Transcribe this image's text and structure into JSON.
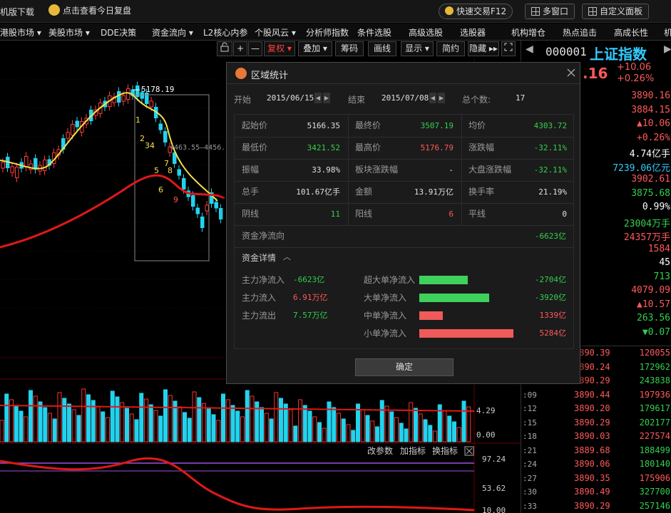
{
  "topbar": {
    "download": "机版下载",
    "review": "点击查看今日复盘",
    "quick_trade": "快速交易F12",
    "multi_window": "多窗口",
    "custom_panel": "自定义面板"
  },
  "nav": [
    "港股市场 ▾",
    "美股市场 ▾",
    "DDE决策",
    "资金流向 ▾",
    "L2核心内参",
    "个股风云 ▾",
    "分析师指数",
    "条件选股",
    "高级选股",
    "选股器",
    "机构增仓",
    "热点追击",
    "高成长性",
    "机"
  ],
  "toolbar": {
    "buttons": [
      "+",
      "—",
      "复权 ▾",
      "叠加 ▾",
      "筹码",
      "画线",
      "显示 ▾",
      "简约",
      "隐藏 ▸▸"
    ]
  },
  "chart": {
    "high_label": "5178.19",
    "range_label": "4463.55—4456.",
    "wave_labels": [
      "1",
      "2",
      "3",
      "4",
      "5",
      "6",
      "7",
      "8",
      "9"
    ],
    "volume_ticks": [
      "4.29",
      "0.00"
    ],
    "indicator_menu": [
      "改参数",
      "加指标",
      "换指标"
    ],
    "indicator_ticks": [
      "97.24",
      "53.62",
      "10.00"
    ]
  },
  "right_panel": {
    "code": "000001",
    "name": "上证指数",
    "price_tail": ".16",
    "change": "+10.06",
    "change_pct": "+0.26%",
    "values": [
      {
        "v": "3890.16",
        "c": "#ff5a5a"
      },
      {
        "v": "3884.15",
        "c": "#ff5a5a"
      },
      {
        "v": "▲10.06",
        "c": "#ff5a5a"
      },
      {
        "v": "+0.26%",
        "c": "#ff5a5a"
      },
      {
        "v": "4.74亿手",
        "c": "#ffffff"
      },
      {
        "v": "7239.06亿元",
        "c": "#33ccff"
      },
      {
        "v": "3902.61",
        "c": "#ff5a5a"
      },
      {
        "v": "3875.68",
        "c": "#33d04e"
      },
      {
        "v": "0.99%",
        "c": "#ffffff"
      },
      {
        "v": "23004万手",
        "c": "#33d04e"
      },
      {
        "v": "24357万手",
        "c": "#ff5a5a"
      },
      {
        "v": "1584",
        "c": "#ff5a5a"
      },
      {
        "v": "45",
        "c": "#ffffff"
      },
      {
        "v": "713",
        "c": "#33d04e"
      },
      {
        "v": "4079.09",
        "c": "#ff5a5a"
      },
      {
        "v": "▲10.57",
        "c": "#ff5a5a"
      },
      {
        "v": "263.56",
        "c": "#33d04e"
      },
      {
        "v": "▼0.07",
        "c": "#33d04e"
      }
    ],
    "ticks": [
      {
        "t": "",
        "p": "3890.39",
        "v": "120055"
      },
      {
        "t": "",
        "p": "3890.24",
        "v": "172962"
      },
      {
        "t": "",
        "p": "3890.29",
        "v": "243838"
      },
      {
        "t": ":09",
        "p": "3890.44",
        "v": "197936"
      },
      {
        "t": ":12",
        "p": "3890.20",
        "v": "179617"
      },
      {
        "t": ":15",
        "p": "3890.29",
        "v": "202177"
      },
      {
        "t": ":18",
        "p": "3890.03",
        "v": "227574"
      },
      {
        "t": ":21",
        "p": "3889.68",
        "v": "188499"
      },
      {
        "t": ":24",
        "p": "3890.06",
        "v": "180140"
      },
      {
        "t": ":27",
        "p": "3890.35",
        "v": "175906"
      },
      {
        "t": ":30",
        "p": "3890.49",
        "v": "327700"
      },
      {
        "t": ":33",
        "p": "3890.29",
        "v": "257146"
      }
    ]
  },
  "dialog": {
    "title": "区域统计",
    "start_label": "开始",
    "start_date": "2015/06/15",
    "end_label": "结束",
    "end_date": "2015/07/08",
    "count_label": "总个数:",
    "count": "17",
    "stats": [
      [
        {
          "l": "起始价",
          "v": "5166.35",
          "c": ""
        },
        {
          "l": "最终价",
          "v": "3507.19",
          "c": "g"
        },
        {
          "l": "均价",
          "v": "4303.72",
          "c": "g"
        }
      ],
      [
        {
          "l": "最低价",
          "v": "3421.52",
          "c": "g"
        },
        {
          "l": "最高价",
          "v": "5176.79",
          "c": "r"
        },
        {
          "l": "涨跌幅",
          "v": "-32.11%",
          "c": "g"
        }
      ],
      [
        {
          "l": "振幅",
          "v": "33.98%",
          "c": ""
        },
        {
          "l": "板块涨跌幅",
          "v": "-",
          "c": ""
        },
        {
          "l": "大盘涨跌幅",
          "v": "-32.11%",
          "c": "g"
        }
      ],
      [
        {
          "l": "总手",
          "v": "101.67亿手",
          "c": ""
        },
        {
          "l": "金额",
          "v": "13.91万亿",
          "c": ""
        },
        {
          "l": "换手率",
          "v": "21.19%",
          "c": ""
        }
      ],
      [
        {
          "l": "阴线",
          "v": "11",
          "c": "g"
        },
        {
          "l": "阳线",
          "v": "6",
          "c": "r"
        },
        {
          "l": "平线",
          "v": "0",
          "c": ""
        }
      ]
    ],
    "net_flow_label": "资金净流向",
    "net_flow_value": "-6623亿",
    "detail_label": "资金详情",
    "main_flows": [
      {
        "l": "主力净流入",
        "v": "-6623亿",
        "c": "g"
      },
      {
        "l": "主力流入",
        "v": "6.91万亿",
        "c": "r"
      },
      {
        "l": "主力流出",
        "v": "7.57万亿",
        "c": "g"
      }
    ],
    "flow_bars": [
      {
        "l": "超大单净流入",
        "v": "-2704亿",
        "c": "g",
        "amount": -2704
      },
      {
        "l": "大单净流入",
        "v": "-3920亿",
        "c": "g",
        "amount": -3920
      },
      {
        "l": "中单净流入",
        "v": "1339亿",
        "c": "r",
        "amount": 1339
      },
      {
        "l": "小单净流入",
        "v": "5284亿",
        "c": "r",
        "amount": 5284
      }
    ],
    "ok_label": "确定"
  },
  "colors": {
    "up": "#ff5a5a",
    "down": "#33d04e",
    "volume_up": "#ff3030",
    "volume_down": "#22d3ee",
    "ma_short": "#f5e04c",
    "ma_long": "#e01818",
    "accent": "#e6b93b"
  }
}
